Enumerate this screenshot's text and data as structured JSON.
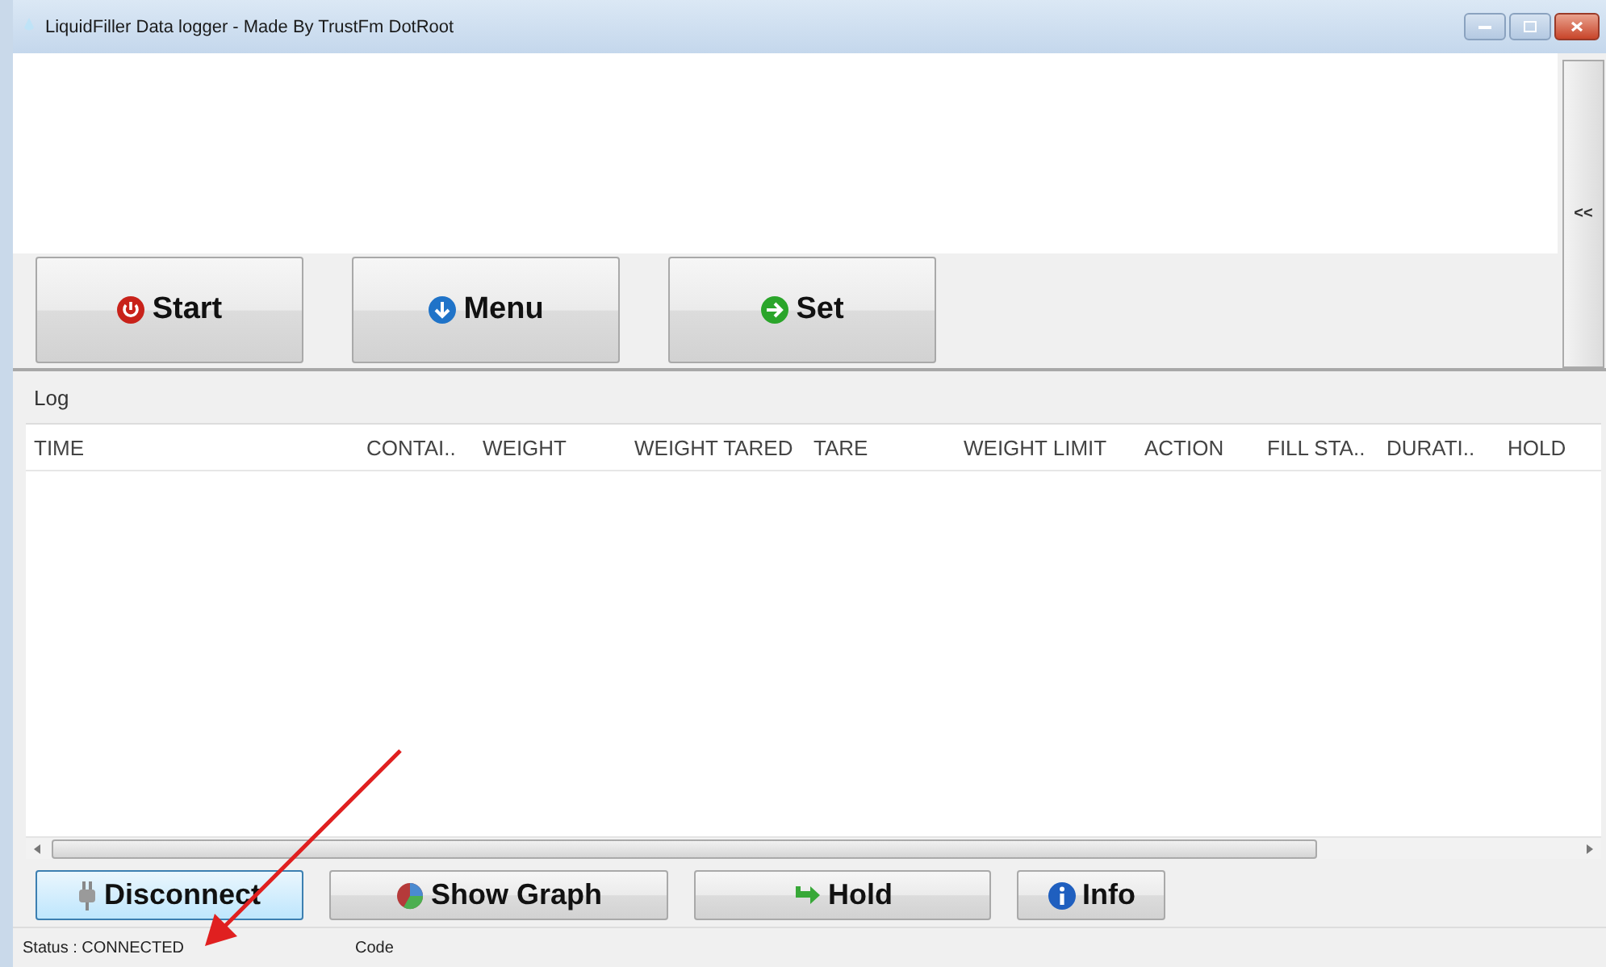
{
  "window": {
    "title": "LiquidFiller Data logger - Made By TrustFm DotRoot"
  },
  "collapse_button": {
    "label": "<<"
  },
  "main_buttons": [
    {
      "label": "Start",
      "kind": "power"
    },
    {
      "label": "Menu",
      "kind": "down"
    },
    {
      "label": "Set",
      "kind": "right"
    }
  ],
  "log": {
    "title": "Log",
    "columns": [
      "TIME",
      "CONTAI..",
      "WEIGHT",
      "WEIGHT TARED",
      "TARE",
      "WEIGHT LIMIT",
      "ACTION",
      "FILL STA..",
      "DURATI..",
      "HOLD"
    ]
  },
  "bottom_buttons": [
    {
      "label": "Disconnect",
      "kind": "plug",
      "focused": true
    },
    {
      "label": "Show Graph",
      "kind": "graph",
      "focused": false
    },
    {
      "label": "Hold",
      "kind": "arrow",
      "focused": false
    },
    {
      "label": "Info",
      "kind": "info",
      "focused": false
    }
  ],
  "status_bar": {
    "status": "Status : CONNECTED",
    "code": "Code"
  },
  "annotation": {
    "kind": "arrow"
  }
}
